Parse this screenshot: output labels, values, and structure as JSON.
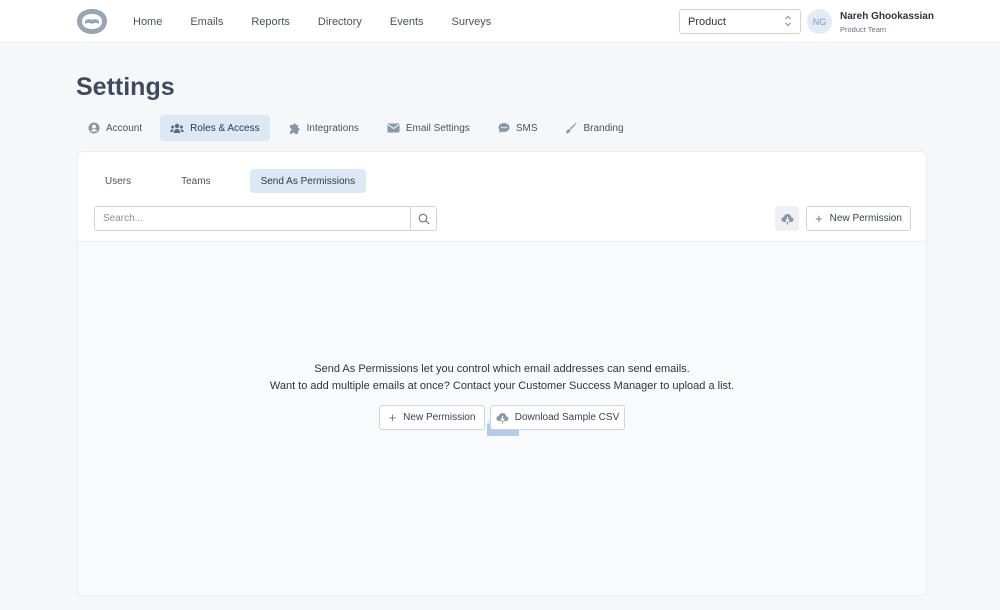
{
  "nav": {
    "items": [
      "Home",
      "Emails",
      "Reports",
      "Directory",
      "Events",
      "Surveys"
    ]
  },
  "org_select": {
    "value": "Product"
  },
  "user": {
    "initials": "NG",
    "name": "Nareh Ghookassian",
    "team": "Product Team"
  },
  "page": {
    "title": "Settings"
  },
  "tabs": [
    {
      "label": "Account",
      "icon": "user-circle-icon"
    },
    {
      "label": "Roles & Access",
      "icon": "users-icon"
    },
    {
      "label": "Integrations",
      "icon": "puzzle-icon"
    },
    {
      "label": "Email Settings",
      "icon": "envelope-icon"
    },
    {
      "label": "SMS",
      "icon": "chat-bubble-icon"
    },
    {
      "label": "Branding",
      "icon": "brush-icon"
    }
  ],
  "subtabs": [
    "Users",
    "Teams",
    "Send As Permissions"
  ],
  "search": {
    "placeholder": "Search..."
  },
  "toolbar": {
    "new_permission_label": "New Permission"
  },
  "empty_state": {
    "line1": "Send As Permissions let you control which email addresses can send emails.",
    "line2": "Want to add multiple emails at once? Contact your Customer Success Manager to upload a list.",
    "new_permission_label": "New Permission",
    "download_csv_label": "Download Sample CSV"
  },
  "colors": {
    "accent_bg": "#dde8f5",
    "icon_grey": "#8a97a8",
    "page_bg": "#f6f7f9"
  }
}
